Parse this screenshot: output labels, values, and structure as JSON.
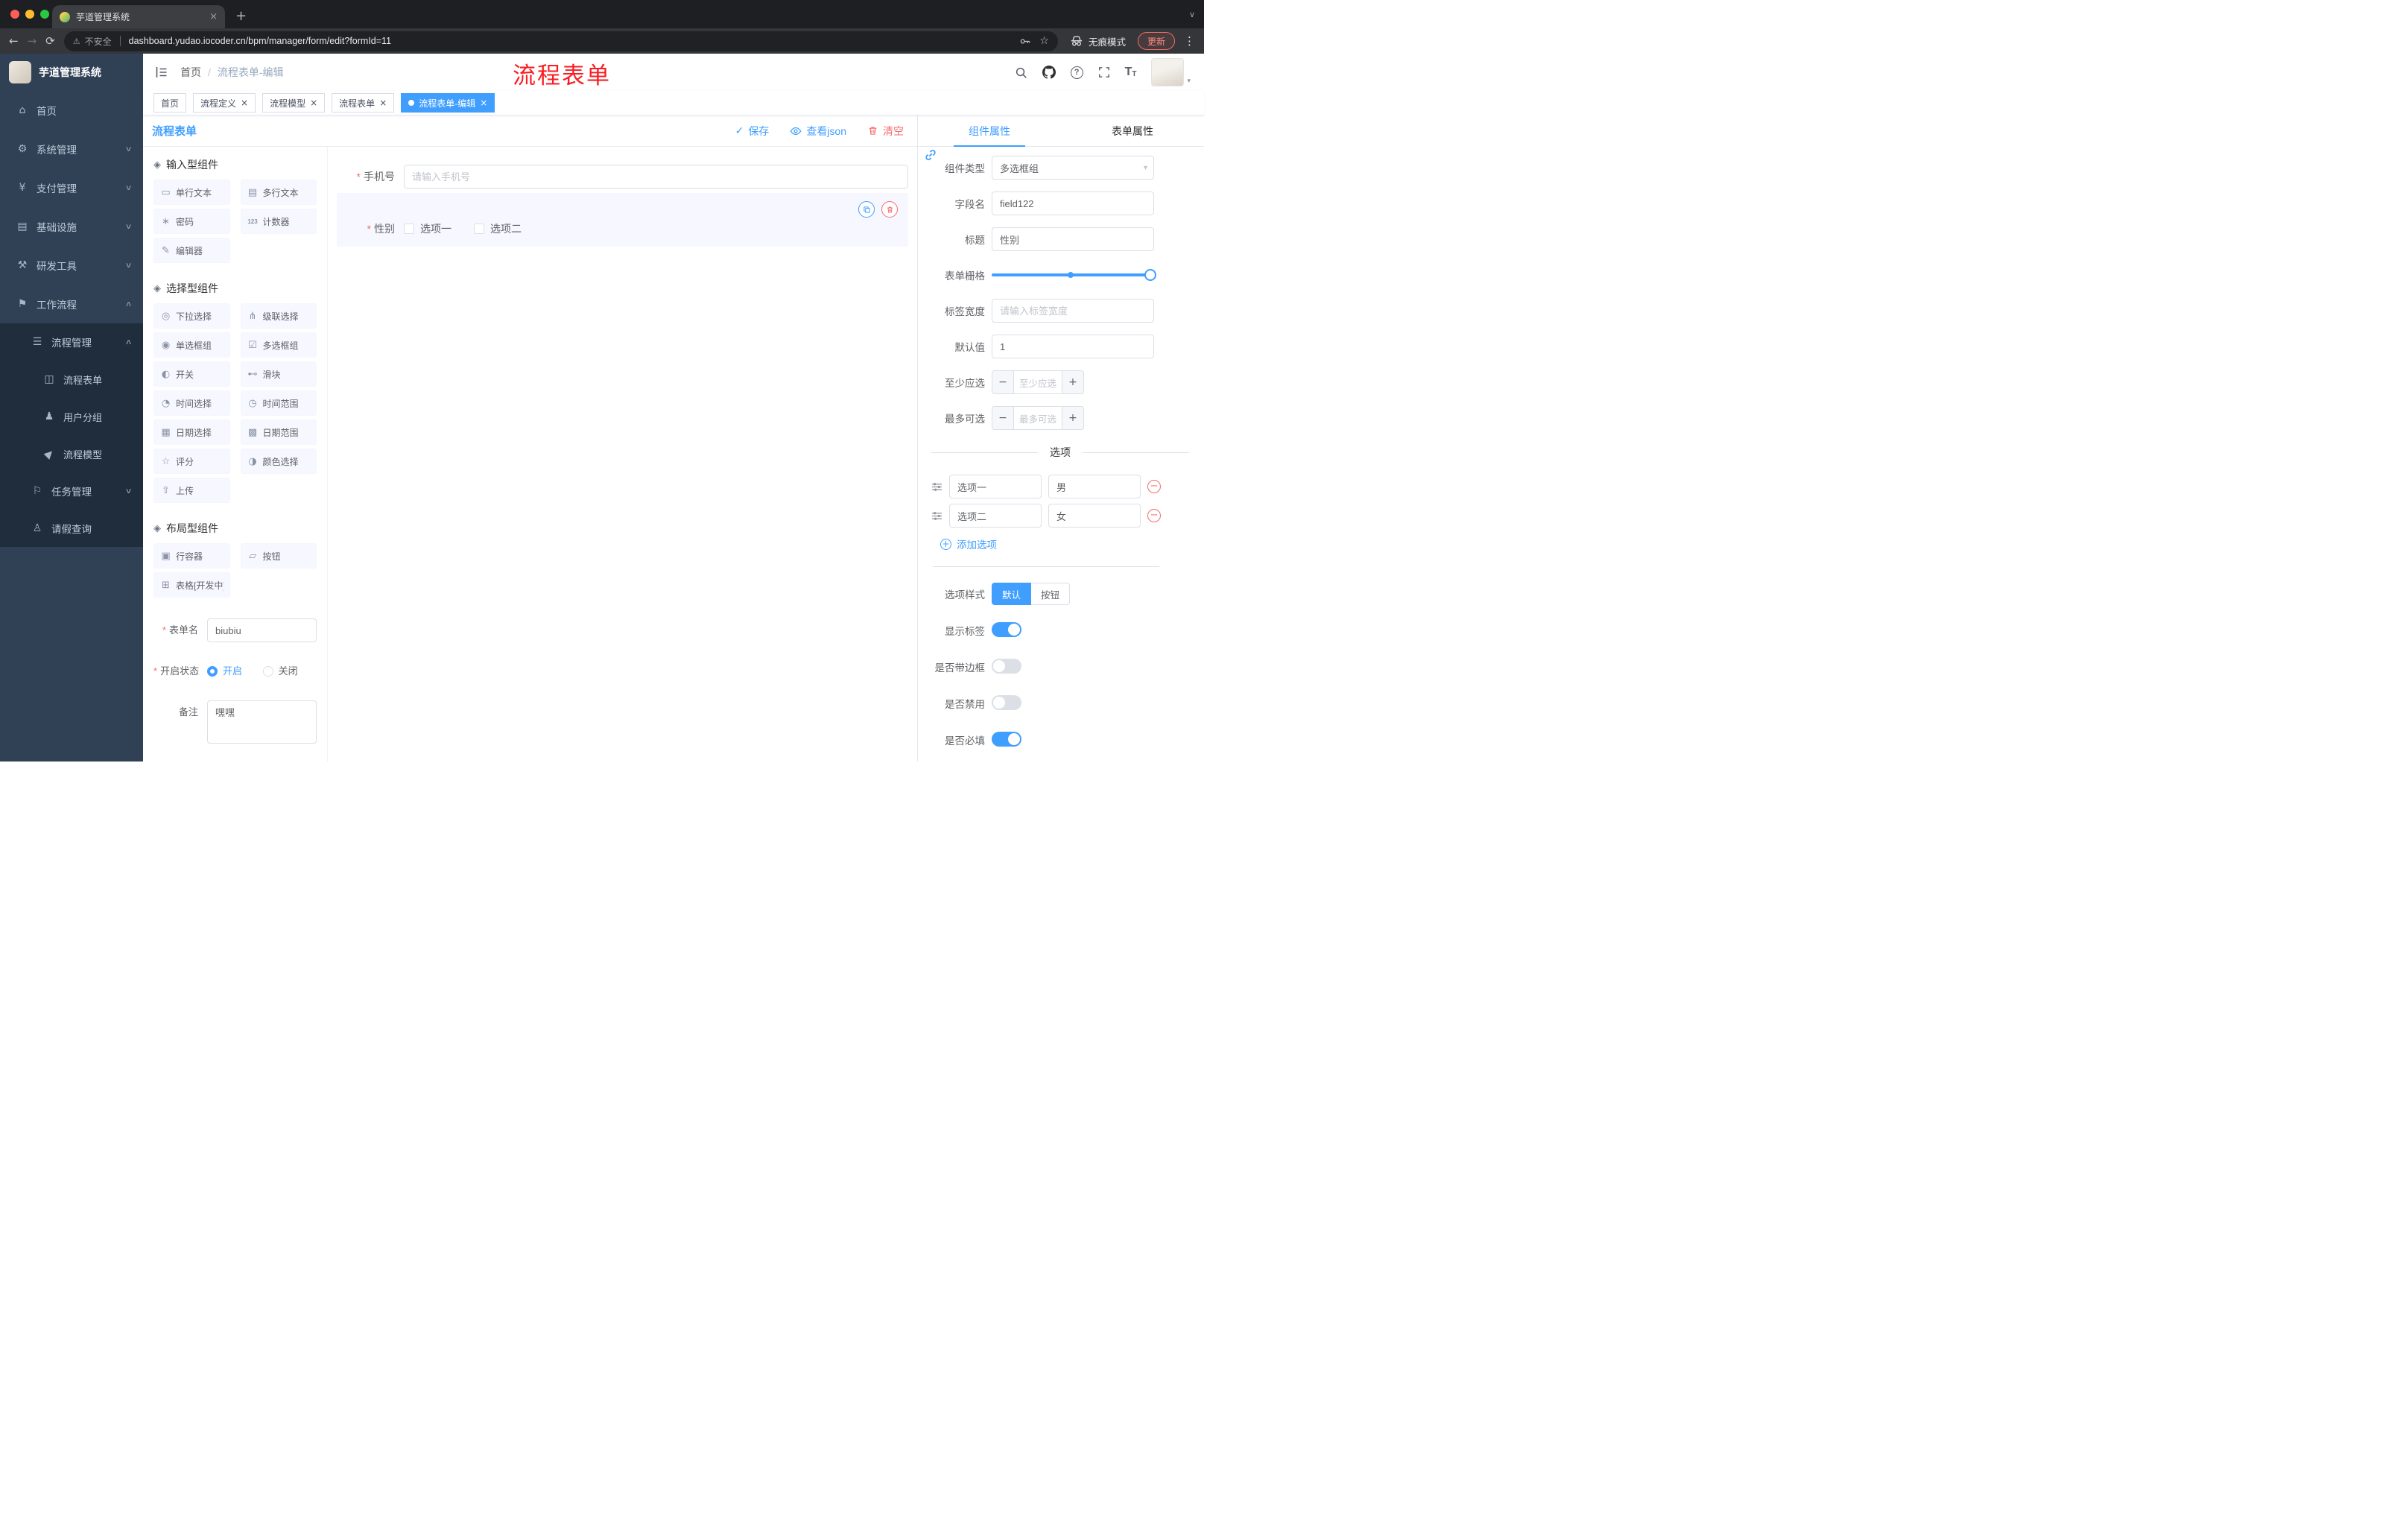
{
  "annotation": "流程表单",
  "browser": {
    "tab_title": "芋道管理系统",
    "security": "不安全",
    "url": "dashboard.yudao.iocoder.cn/bpm/manager/form/edit?formId=11",
    "incognito": "无痕模式",
    "update": "更新"
  },
  "sidebar": {
    "title": "芋道管理系统",
    "menu": [
      {
        "label": "首页"
      },
      {
        "label": "系统管理"
      },
      {
        "label": "支付管理"
      },
      {
        "label": "基础设施"
      },
      {
        "label": "研发工具"
      },
      {
        "label": "工作流程"
      }
    ],
    "submenu": [
      {
        "label": "流程管理"
      },
      {
        "label": "流程表单"
      },
      {
        "label": "用户分组"
      },
      {
        "label": "流程模型"
      },
      {
        "label": "任务管理"
      },
      {
        "label": "请假查询"
      }
    ]
  },
  "header": {
    "crumb1": "首页",
    "crumb2": "流程表单-编辑"
  },
  "tags": {
    "t0": "首页",
    "t1": "流程定义",
    "t2": "流程模型",
    "t3": "流程表单",
    "t4": "流程表单-编辑"
  },
  "editor": {
    "title": "流程表单",
    "save": "保存",
    "view_json": "查看json",
    "clear": "清空"
  },
  "palette": {
    "s0": {
      "title": "输入型组件",
      "i0": "单行文本",
      "i1": "多行文本",
      "i2": "密码",
      "i3": "计数器",
      "i4": "编辑器"
    },
    "s1": {
      "title": "选择型组件",
      "i0": "下拉选择",
      "i1": "级联选择",
      "i2": "单选框组",
      "i3": "多选框组",
      "i4": "开关",
      "i5": "滑块",
      "i6": "时间选择",
      "i7": "时间范围",
      "i8": "日期选择",
      "i9": "日期范围",
      "i10": "评分",
      "i11": "颜色选择",
      "i12": "上传"
    },
    "s2": {
      "title": "布局型组件",
      "i0": "行容器",
      "i1": "按钮",
      "i2": "表格[开发中]"
    }
  },
  "meta": {
    "name_label": "表单名",
    "name_value": "biubiu",
    "status_label": "开启状态",
    "status_on": "开启",
    "status_off": "关闭",
    "remark_label": "备注",
    "remark_value": "嘿嘿"
  },
  "canvas": {
    "phone_label": "手机号",
    "phone_placeholder": "请输入手机号",
    "gender_label": "性别",
    "gender_opt1": "选项一",
    "gender_opt2": "选项二"
  },
  "props": {
    "tab_component": "组件属性",
    "tab_form": "表单属性",
    "type_label": "组件类型",
    "type_value": "多选框组",
    "field_label": "字段名",
    "field_value": "field122",
    "title_label": "标题",
    "title_value": "性别",
    "grid_label": "表单栅格",
    "width_label": "标签宽度",
    "width_placeholder": "请输入标签宽度",
    "default_label": "默认值",
    "default_value": "1",
    "min_label": "至少应选",
    "min_placeholder": "至少应选",
    "max_label": "最多可选",
    "max_placeholder": "最多可选",
    "options_title": "选项",
    "opt1_name": "选项一",
    "opt1_value": "男",
    "opt2_name": "选项二",
    "opt2_value": "女",
    "add_option": "添加选项",
    "style_label": "选项样式",
    "style_default": "默认",
    "style_button": "按钮",
    "show_label": "显示标签",
    "border_label": "是否带边框",
    "disabled_label": "是否禁用",
    "required_label": "是否必填"
  }
}
